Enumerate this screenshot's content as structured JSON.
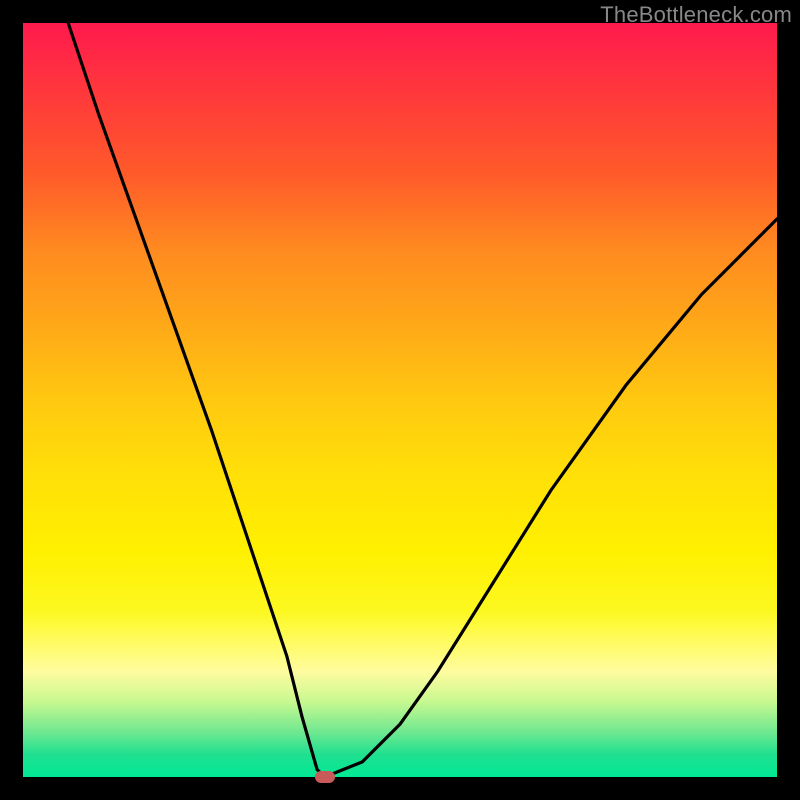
{
  "watermark": "TheBottleneck.com",
  "chart_data": {
    "type": "line",
    "title": "",
    "xlabel": "",
    "ylabel": "",
    "xlim": [
      0,
      100
    ],
    "ylim": [
      0,
      100
    ],
    "background": "rainbow-gradient-red-to-green",
    "series": [
      {
        "name": "bottleneck-curve",
        "x": [
          6,
          10,
          15,
          20,
          25,
          30,
          33,
          35,
          37,
          39,
          40,
          45,
          50,
          55,
          60,
          65,
          70,
          75,
          80,
          85,
          90,
          95,
          100
        ],
        "y": [
          100,
          88,
          74,
          60,
          46,
          31,
          22,
          16,
          8,
          1,
          0,
          2,
          7,
          14,
          22,
          30,
          38,
          45,
          52,
          58,
          64,
          69,
          74
        ]
      }
    ],
    "marker": {
      "x": 40,
      "y": 0,
      "color": "#c85a5a"
    },
    "gradient_stops": [
      {
        "pos": 0,
        "color": "#ff1a4d"
      },
      {
        "pos": 50,
        "color": "#ffe000"
      },
      {
        "pos": 100,
        "color": "#00e894"
      }
    ]
  }
}
